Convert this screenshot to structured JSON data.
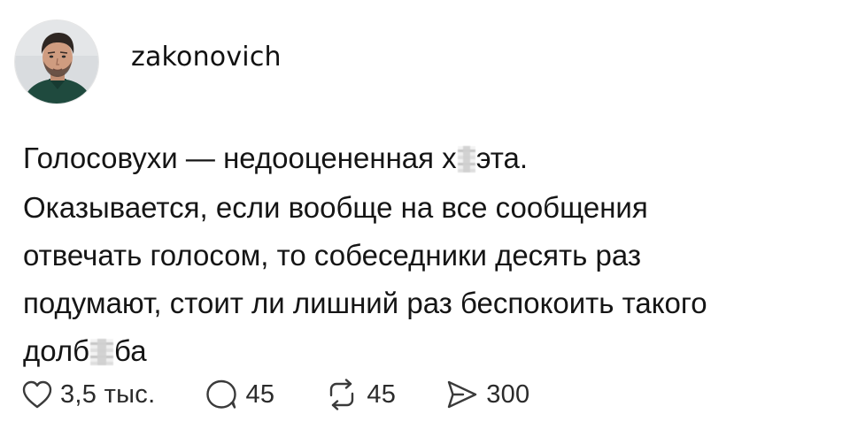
{
  "post": {
    "username": "zakonovich",
    "lines": {
      "l1_a": "Голосовухи — недооцененная х",
      "l1_b": "эта.",
      "l2": "Оказывается, если вообще на все сообщения",
      "l3": "отвечать голосом, то собеседники десять раз",
      "l4": "подумают, стоит ли лишний раз беспокоить такого",
      "l5_a": "долб",
      "l5_b": "ба"
    }
  },
  "actions": {
    "likes": "3,5 тыс.",
    "comments": "45",
    "reposts": "45",
    "shares": "300"
  },
  "icons": {
    "like": "heart-icon",
    "comment": "speech-bubble-icon",
    "repost": "repost-arrows-icon",
    "share": "send-icon"
  },
  "colors": {
    "text": "#151515",
    "icon": "#3a3a3a",
    "background": "#ffffff"
  }
}
